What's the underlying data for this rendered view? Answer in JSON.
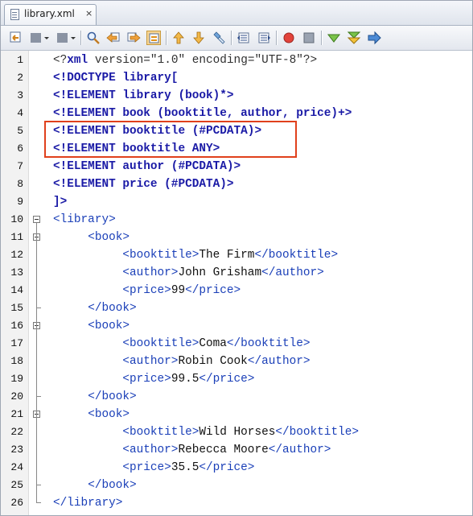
{
  "tab": {
    "label": "library.xml",
    "close": "×"
  },
  "toolbar": {
    "buttons": [
      "back-icon",
      "source-history-icon",
      "forward-history-icon",
      "find-icon",
      "find-previous-icon",
      "find-next-icon",
      "highlight-icon",
      "previous-bookmark-icon",
      "next-bookmark-icon",
      "toggle-bookmark-icon",
      "shift-left-icon",
      "shift-right-icon",
      "record-macro-icon",
      "stop-macro-icon",
      "check-xml-icon",
      "validate-xml-icon",
      "xsl-transform-icon"
    ]
  },
  "editor": {
    "line_numbers": [
      "1",
      "2",
      "3",
      "4",
      "5",
      "6",
      "7",
      "8",
      "9",
      "10",
      "11",
      "12",
      "13",
      "14",
      "15",
      "16",
      "17",
      "18",
      "19",
      "20",
      "21",
      "22",
      "23",
      "24",
      "25",
      "26"
    ],
    "lines": [
      {
        "indent": "",
        "parts": [
          [
            "pi",
            "<?"
          ],
          [
            "pib",
            "xml"
          ],
          [
            "pi",
            " version=\"1.0\" encoding=\"UTF-8\"?>"
          ]
        ]
      },
      {
        "indent": "",
        "parts": [
          [
            "decl",
            "<!DOCTYPE library["
          ]
        ]
      },
      {
        "indent": "",
        "parts": [
          [
            "decl",
            "<!ELEMENT library (book)*>"
          ]
        ]
      },
      {
        "indent": "",
        "parts": [
          [
            "decl",
            "<!ELEMENT book (booktitle, author, price)+>"
          ]
        ]
      },
      {
        "indent": "",
        "parts": [
          [
            "decl",
            "<!ELEMENT booktitle (#PCDATA)>"
          ]
        ]
      },
      {
        "indent": "",
        "parts": [
          [
            "decl",
            "<!ELEMENT booktitle ANY>"
          ]
        ]
      },
      {
        "indent": "",
        "parts": [
          [
            "decl",
            "<!ELEMENT author (#PCDATA)>"
          ]
        ]
      },
      {
        "indent": "",
        "parts": [
          [
            "decl",
            "<!ELEMENT price (#PCDATA)>"
          ]
        ]
      },
      {
        "indent": "",
        "parts": [
          [
            "decl",
            "]>"
          ]
        ]
      },
      {
        "indent": "",
        "parts": [
          [
            "tag",
            "<library>"
          ]
        ]
      },
      {
        "indent": "     ",
        "parts": [
          [
            "tag",
            "<book>"
          ]
        ]
      },
      {
        "indent": "          ",
        "parts": [
          [
            "tag",
            "<booktitle>"
          ],
          [
            "txt",
            "The Firm"
          ],
          [
            "tag",
            "</booktitle>"
          ]
        ]
      },
      {
        "indent": "          ",
        "parts": [
          [
            "tag",
            "<author>"
          ],
          [
            "txt",
            "John Grisham"
          ],
          [
            "tag",
            "</author>"
          ]
        ]
      },
      {
        "indent": "          ",
        "parts": [
          [
            "tag",
            "<price>"
          ],
          [
            "txt",
            "99"
          ],
          [
            "tag",
            "</price>"
          ]
        ]
      },
      {
        "indent": "     ",
        "parts": [
          [
            "tag",
            "</book>"
          ]
        ]
      },
      {
        "indent": "     ",
        "parts": [
          [
            "tag",
            "<book>"
          ]
        ]
      },
      {
        "indent": "          ",
        "parts": [
          [
            "tag",
            "<booktitle>"
          ],
          [
            "txt",
            "Coma"
          ],
          [
            "tag",
            "</booktitle>"
          ]
        ]
      },
      {
        "indent": "          ",
        "parts": [
          [
            "tag",
            "<author>"
          ],
          [
            "txt",
            "Robin Cook"
          ],
          [
            "tag",
            "</author>"
          ]
        ]
      },
      {
        "indent": "          ",
        "parts": [
          [
            "tag",
            "<price>"
          ],
          [
            "txt",
            "99.5"
          ],
          [
            "tag",
            "</price>"
          ]
        ]
      },
      {
        "indent": "     ",
        "parts": [
          [
            "tag",
            "</book>"
          ]
        ]
      },
      {
        "indent": "     ",
        "parts": [
          [
            "tag",
            "<book>"
          ]
        ]
      },
      {
        "indent": "          ",
        "parts": [
          [
            "tag",
            "<booktitle>"
          ],
          [
            "txt",
            "Wild Horses"
          ],
          [
            "tag",
            "</booktitle>"
          ]
        ]
      },
      {
        "indent": "          ",
        "parts": [
          [
            "tag",
            "<author>"
          ],
          [
            "txt",
            "Rebecca Moore"
          ],
          [
            "tag",
            "</author>"
          ]
        ]
      },
      {
        "indent": "          ",
        "parts": [
          [
            "tag",
            "<price>"
          ],
          [
            "txt",
            "35.5"
          ],
          [
            "tag",
            "</price>"
          ]
        ]
      },
      {
        "indent": "     ",
        "parts": [
          [
            "tag",
            "</book>"
          ]
        ]
      },
      {
        "indent": "",
        "parts": [
          [
            "tag",
            "</library>"
          ]
        ]
      }
    ]
  },
  "colors": {
    "highlight_border": "#e0401c",
    "tag": "#1a3fb8",
    "declaration": "#1a1aa6"
  }
}
